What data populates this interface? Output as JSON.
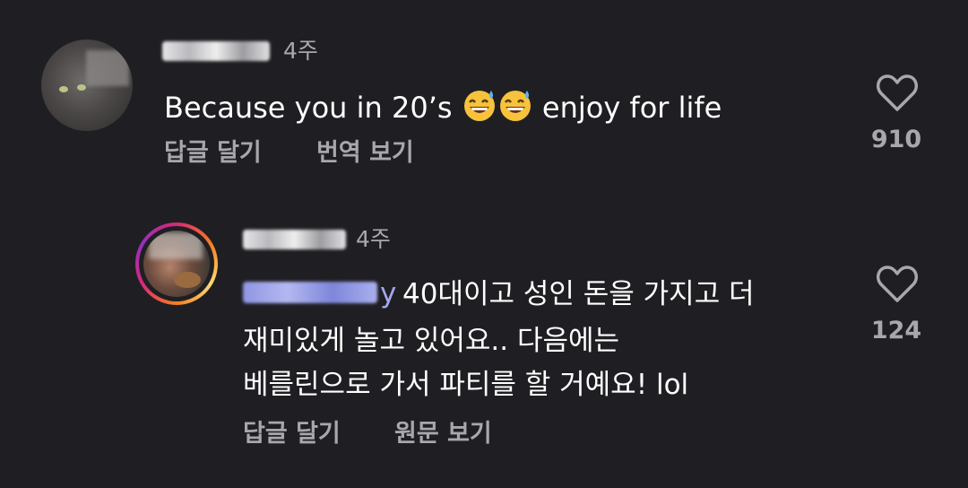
{
  "comments": [
    {
      "time": "4주",
      "text_before_emoji": "Because you in 20’s ",
      "text_after_emoji": " enjoy for life",
      "emoji_name": "grinning-face-with-sweat",
      "reply_label": "답글 달기",
      "translate_label": "번역 보기",
      "likes": "910"
    },
    {
      "time": "4주",
      "mention_tail": "y",
      "lines": [
        "40대이고 성인 돈을 가지고 더",
        "재미있게 놀고 있어요.. 다음에는",
        "베를린으로 가서 파티를 할 거예요! lol"
      ],
      "reply_label": "답글 달기",
      "original_label": "원문 보기",
      "likes": "124"
    }
  ],
  "colors": {
    "background": "#1f1f23",
    "secondary_text": "#a7a7ac",
    "mention": "#a3a8ef",
    "story_ring": "#d62976"
  }
}
